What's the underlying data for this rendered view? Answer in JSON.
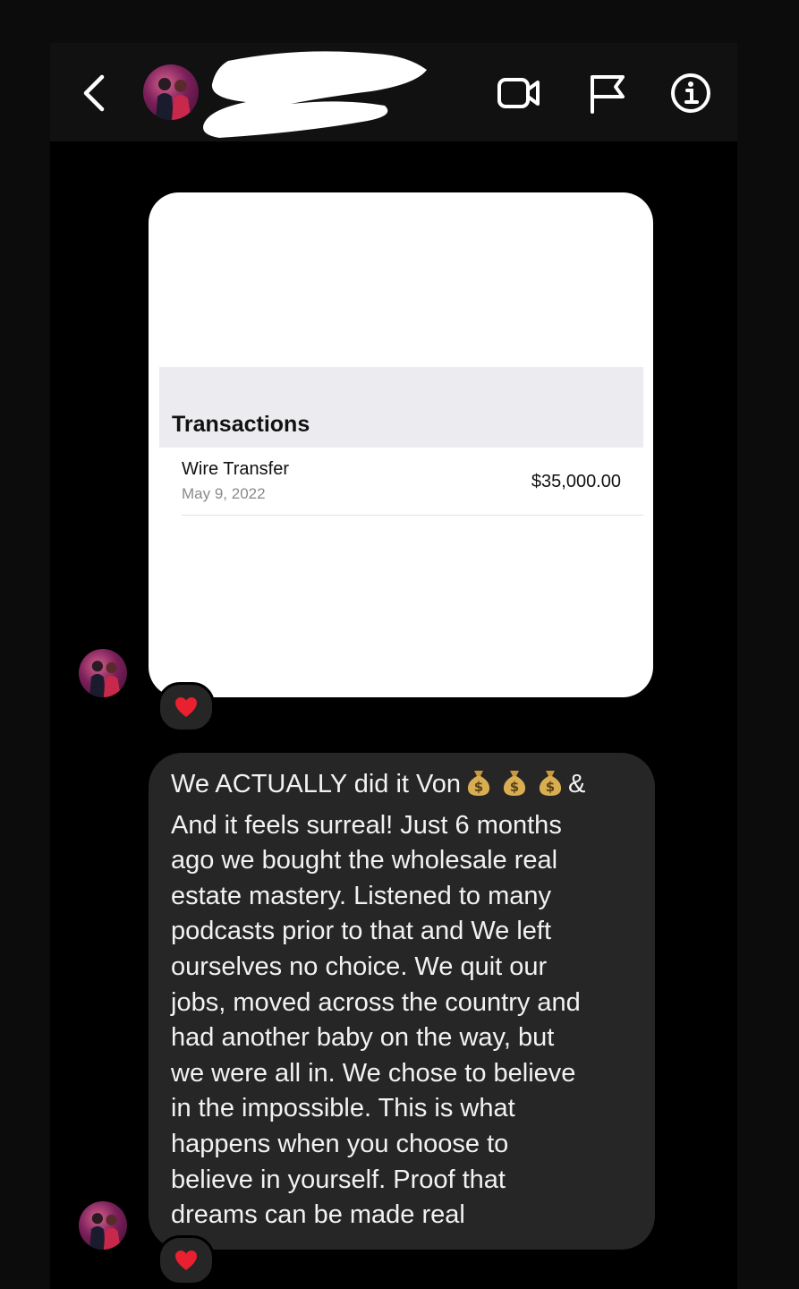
{
  "header": {
    "back_icon": "chevron-left-icon",
    "contact_name": "",
    "actions": [
      {
        "name": "video-call",
        "icon": "video-camera-icon"
      },
      {
        "name": "report",
        "icon": "flag-icon"
      },
      {
        "name": "details",
        "icon": "info-icon"
      }
    ]
  },
  "messages": [
    {
      "type": "image",
      "content": {
        "section_title": "Transactions",
        "transaction": {
          "name": "Wire Transfer",
          "date": "May 9, 2022",
          "amount": "$35,000.00"
        }
      },
      "reaction": "❤️"
    },
    {
      "type": "text",
      "line1_start": "We ACTUALLY did it Von",
      "emojis": [
        "money-bag",
        "money-bag",
        "money-bag"
      ],
      "line1_end": "&",
      "body": "And it feels surreal! Just 6 months\nago we bought the wholesale real\nestate mastery. Listened to many\npodcasts prior to that and We left\nourselves no choice. We quit our\njobs, moved across the country and\nhad another baby on the way, but\nwe were all in. We chose to believe\nin the impossible. This is what\nhappens when you choose to\nbelieve in yourself. Proof that\ndreams can be made real",
      "reaction": "❤️"
    }
  ],
  "colors": {
    "background": "#000000",
    "bubble": "#262626",
    "text": "#f2f2f2",
    "heart": "#e8202f"
  }
}
